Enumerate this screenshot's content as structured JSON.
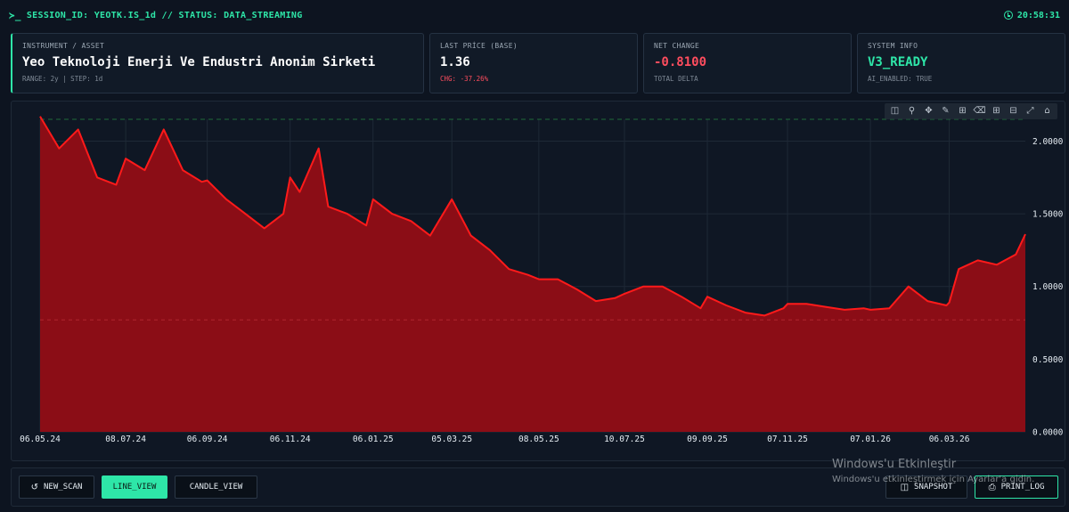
{
  "header": {
    "session_text": "SESSION_ID: YEOTK.IS_1d // STATUS: DATA_STREAMING",
    "prompt": "≻_",
    "time": "20:58:31"
  },
  "cards": {
    "instrument": {
      "label": "INSTRUMENT / ASSET",
      "value": "Yeo Teknoloji Enerji Ve Endustri Anonim Sirketi",
      "sub": "RANGE: 2y | STEP: 1d"
    },
    "last_price": {
      "label": "LAST PRİCE (BASE)",
      "value": "1.36",
      "sub": "CHG: -37.26%"
    },
    "net_change": {
      "label": "NET CHANGE",
      "value": "-0.8100",
      "sub": "TOTAL DELTA"
    },
    "system": {
      "label": "SYSTEM INFO",
      "value": "V3_READY",
      "sub": "AI_ENABLED: TRUE"
    }
  },
  "modebar": [
    "camera-icon",
    "zoom-icon",
    "pan-icon",
    "lasso-icon",
    "box-select-icon",
    "eraser-icon",
    "zoom-in-icon",
    "zoom-out-icon",
    "autoscale-icon",
    "home-icon"
  ],
  "colors": {
    "accent": "#2ee6a8",
    "line": "#ff1a1a",
    "fill": "#8b0d16",
    "negative": "#ff4d5e"
  },
  "chart_data": {
    "type": "area",
    "x_tick_labels": [
      "06.05.24",
      "08.07.24",
      "06.09.24",
      "06.11.24",
      "06.01.25",
      "05.03.25",
      "08.05.25",
      "10.07.25",
      "09.09.25",
      "07.11.25",
      "07.01.26",
      "06.03.26"
    ],
    "y_tick_labels": [
      "0.0000",
      "0.5000",
      "1.0000",
      "1.5000",
      "2.0000"
    ],
    "ylim": [
      0,
      2.15
    ],
    "reference_lines": [
      2.15,
      0.77
    ],
    "points": [
      [
        "06.05.24",
        2.17
      ],
      [
        "20.05.24",
        1.95
      ],
      [
        "03.06.24",
        2.08
      ],
      [
        "17.06.24",
        1.75
      ],
      [
        "01.07.24",
        1.7
      ],
      [
        "08.07.24",
        1.88
      ],
      [
        "22.07.24",
        1.8
      ],
      [
        "05.08.24",
        2.08
      ],
      [
        "19.08.24",
        1.8
      ],
      [
        "02.09.24",
        1.72
      ],
      [
        "06.09.24",
        1.73
      ],
      [
        "20.09.24",
        1.6
      ],
      [
        "04.10.24",
        1.5
      ],
      [
        "18.10.24",
        1.4
      ],
      [
        "01.11.24",
        1.5
      ],
      [
        "06.11.24",
        1.75
      ],
      [
        "13.11.24",
        1.65
      ],
      [
        "27.11.24",
        1.95
      ],
      [
        "04.12.24",
        1.55
      ],
      [
        "18.12.24",
        1.5
      ],
      [
        "01.01.25",
        1.42
      ],
      [
        "06.01.25",
        1.6
      ],
      [
        "20.01.25",
        1.5
      ],
      [
        "03.02.25",
        1.45
      ],
      [
        "17.02.25",
        1.35
      ],
      [
        "05.03.25",
        1.6
      ],
      [
        "19.03.25",
        1.35
      ],
      [
        "02.04.25",
        1.25
      ],
      [
        "16.04.25",
        1.12
      ],
      [
        "30.04.25",
        1.08
      ],
      [
        "08.05.25",
        1.05
      ],
      [
        "22.05.25",
        1.05
      ],
      [
        "05.06.25",
        0.98
      ],
      [
        "19.06.25",
        0.9
      ],
      [
        "03.07.25",
        0.92
      ],
      [
        "10.07.25",
        0.95
      ],
      [
        "24.07.25",
        1.0
      ],
      [
        "07.08.25",
        1.0
      ],
      [
        "21.08.25",
        0.93
      ],
      [
        "04.09.25",
        0.85
      ],
      [
        "09.09.25",
        0.93
      ],
      [
        "23.09.25",
        0.87
      ],
      [
        "07.10.25",
        0.82
      ],
      [
        "21.10.25",
        0.8
      ],
      [
        "04.11.25",
        0.85
      ],
      [
        "07.11.25",
        0.88
      ],
      [
        "21.11.25",
        0.88
      ],
      [
        "05.12.25",
        0.86
      ],
      [
        "19.12.25",
        0.84
      ],
      [
        "02.01.26",
        0.85
      ],
      [
        "07.01.26",
        0.84
      ],
      [
        "21.01.26",
        0.85
      ],
      [
        "04.02.26",
        1.0
      ],
      [
        "18.02.26",
        0.9
      ],
      [
        "04.03.26",
        0.87
      ],
      [
        "06.03.26",
        0.89
      ],
      [
        "13.03.26",
        1.12
      ],
      [
        "27.03.26",
        1.18
      ],
      [
        "10.04.26",
        1.15
      ],
      [
        "24.04.26",
        1.22
      ],
      [
        "01.05.26",
        1.36
      ]
    ]
  },
  "buttons": {
    "new_scan": "NEW_SCAN",
    "line_view": "LINE_VIEW",
    "candle_view": "CANDLE_VIEW",
    "snapshot": "SNAPSHOT",
    "print_log": "PRINT_LOG"
  },
  "watermark": {
    "line1": "Windows'u Etkinleştir",
    "line2": "Windows'u etkinleştirmek için Ayarlar'a gidin."
  }
}
